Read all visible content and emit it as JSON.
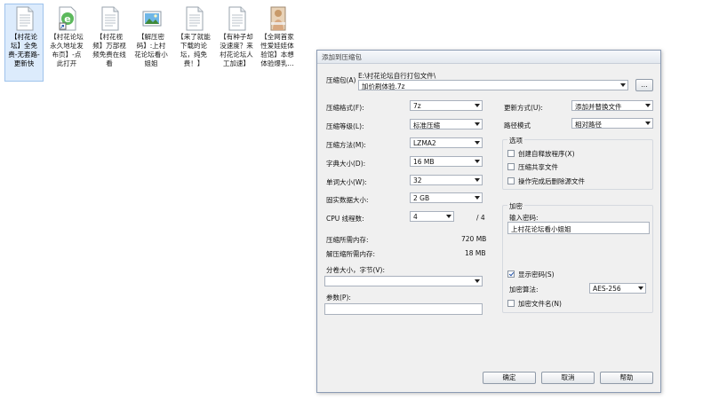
{
  "desktop": {
    "icons": [
      {
        "caption": "【村花论坛】全免费-无套路-更新快",
        "icon": "text-document-icon"
      },
      {
        "caption": "【村花论坛永久地址发布页】-点此打开",
        "icon": "ie-shortcut-icon"
      },
      {
        "caption": "【村花视频】万部视频免费在线看",
        "icon": "text-document-icon"
      },
      {
        "caption": "【解压密码】:上村花论坛看小姐姐",
        "icon": "image-file-icon"
      },
      {
        "caption": "【来了就能下载的论坛，纯免费！】",
        "icon": "text-document-icon"
      },
      {
        "caption": "【有种子却没速度？来村花论坛人工加速】",
        "icon": "text-document-icon"
      },
      {
        "caption": "【全网首家性爱娃娃体验馆】本想体验爆乳...",
        "icon": "photo-file-icon"
      }
    ]
  },
  "dialog": {
    "title": "添加到压缩包",
    "archive_label": "压缩包(A)",
    "archive_path": "E:\\村花论坛自行打包文件\\",
    "archive_name": "加价刷体验.7z",
    "browse_label": "...",
    "format_label": "压缩格式(F):",
    "format_value": "7z",
    "level_label": "压缩等级(L):",
    "level_value": "标准压缩",
    "method_label": "压缩方法(M):",
    "method_value": "LZMA2",
    "dict_label": "字典大小(D):",
    "dict_value": "16 MB",
    "word_label": "单词大小(W):",
    "word_value": "32",
    "solid_label": "固实数据大小:",
    "solid_value": "2 GB",
    "cpu_label": "CPU 线程数:",
    "cpu_value": "4",
    "cpu_total": "/ 4",
    "mem_comp_label": "压缩所需内存:",
    "mem_comp_value": "720 MB",
    "mem_decomp_label": "解压缩所需内存:",
    "mem_decomp_value": "18 MB",
    "split_label": "分卷大小，字节(V):",
    "split_value": "",
    "params_label": "参数(P):",
    "params_value": "",
    "update_label": "更新方式(U):",
    "update_value": "添加并替换文件",
    "pathmode_label": "路径模式",
    "pathmode_value": "相对路径",
    "options_title": "选项",
    "opt_sfx": "创建自释放程序(X)",
    "opt_shared": "压缩共享文件",
    "opt_delete": "操作完成后删除源文件",
    "encrypt_title": "加密",
    "password_label": "输入密码:",
    "password_value": "上村花论坛看小姐姐",
    "show_password": "显示密码(S)",
    "enc_method_label": "加密算法:",
    "enc_method_value": "AES-256",
    "enc_names": "加密文件名(N)",
    "ok_label": "确定",
    "cancel_label": "取消",
    "help_label": "帮助"
  }
}
